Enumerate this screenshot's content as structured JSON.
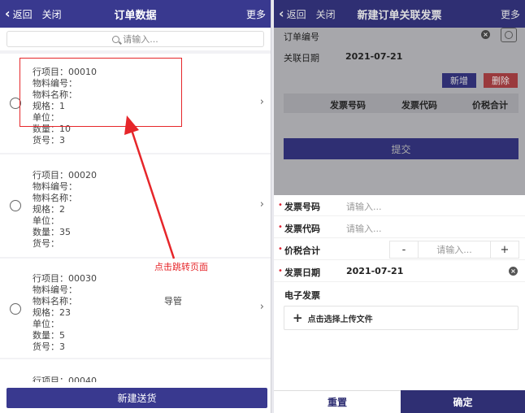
{
  "left": {
    "nav": {
      "back": "返回",
      "close": "关闭",
      "title": "订单数据",
      "more": "更多"
    },
    "search": {
      "placeholder": "请输入..."
    },
    "cards": [
      {
        "lines": [
          "行项目：00010",
          "物料编号：",
          "物料名称：",
          "规格：1",
          "单位：",
          "数量：10",
          "货号：3"
        ]
      },
      {
        "lines": [
          "行项目：00020",
          "物料编号：",
          "物料名称：",
          "规格：2",
          "单位：",
          "数量：35",
          "货号："
        ]
      },
      {
        "lines": [
          "行项目：00030",
          "物料编号：",
          "物料名称：",
          "规格：23",
          "单位：",
          "数量：5",
          "货号：3"
        ]
      },
      {
        "lines": [
          "行项目：00040"
        ]
      }
    ],
    "material_name_suffix": "导管",
    "bottom_button": "新建送货",
    "annotation": "点击跳转页面"
  },
  "right": {
    "nav": {
      "back": "返回",
      "close": "关闭",
      "title": "新建订单关联发票",
      "more": "更多"
    },
    "order_no_label": "订单编号",
    "link_date_label": "关联日期",
    "link_date_value": "2021-07-21",
    "add_button": "新增",
    "delete_button": "删除",
    "table_headers": [
      "发票号码",
      "发票代码",
      "价税合计"
    ],
    "submit_button": "提交",
    "form": {
      "invoice_no": {
        "label": "发票号码",
        "placeholder": "请输入..."
      },
      "invoice_code": {
        "label": "发票代码",
        "placeholder": "请输入..."
      },
      "total": {
        "label": "价税合计",
        "minus": "-",
        "placeholder": "请输入...",
        "plus": "+"
      },
      "invoice_date": {
        "label": "发票日期",
        "value": "2021-07-21"
      },
      "e_invoice_label": "电子发票",
      "upload_label": "点击选择上传文件"
    },
    "reset_button": "重置",
    "confirm_button": "确定"
  },
  "colors": {
    "primary": "#39398f",
    "annotation": "#e6262a",
    "danger": "#9a3a3d"
  },
  "icons": [
    "chevron-left-icon",
    "search-icon",
    "radio-icon",
    "chevron-right-icon",
    "clear-icon",
    "scan-icon",
    "plus-icon"
  ]
}
